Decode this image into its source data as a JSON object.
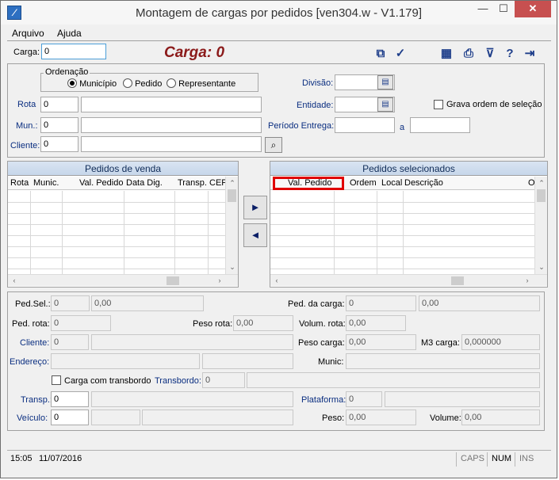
{
  "window": {
    "title": "Montagem de cargas por pedidos [ven304.w - V1.179]",
    "controls": {
      "minimize": "—",
      "maximize": "☐",
      "close": "✕"
    }
  },
  "menu": {
    "arquivo": "Arquivo",
    "ajuda": "Ajuda"
  },
  "header": {
    "carga_label": "Carga:",
    "carga_value": "0",
    "carga_big_label": "Carga:",
    "carga_big_value": "0"
  },
  "toolbar_icons": [
    "copy-icon",
    "confirm-check-icon",
    "calculator-icon",
    "print-icon",
    "filter-icon",
    "help-icon",
    "exit-icon"
  ],
  "filters": {
    "ordenacao_label": "Ordenação",
    "radio_municipio": "Município",
    "radio_pedido": "Pedido",
    "radio_representante": "Representante",
    "selected_radio": "Município",
    "rota_label": "Rota",
    "rota_value": "0",
    "rota_desc": "",
    "mun_label": "Mun.:",
    "mun_value": "0",
    "mun_desc": "",
    "cliente_label": "Cliente:",
    "cliente_value": "0",
    "cliente_desc": "",
    "divisao_label": "Divisão:",
    "divisao_value": "",
    "entidade_label": "Entidade:",
    "entidade_value": "",
    "grava_ordem_label": "Grava ordem de seleção",
    "grava_ordem_checked": false,
    "periodo_label": "Período Entrega:",
    "periodo_sep": "a",
    "periodo_de": "",
    "periodo_ate": ""
  },
  "pedidos_venda": {
    "title": "Pedidos de venda",
    "columns": [
      "Rota",
      "Munic.",
      "Val. Pedido",
      "Data Dig.",
      "Transp.",
      "CEP"
    ],
    "rows": []
  },
  "pedidos_selecionados": {
    "title": "Pedidos selecionados",
    "columns": [
      "Val. Pedido",
      "Ordem",
      "Local",
      "Descrição",
      "O"
    ],
    "rows": []
  },
  "move_buttons": {
    "add": "►",
    "remove": "◄"
  },
  "details": {
    "ped_sel_label": "Ped.Sel.:",
    "ped_sel_value": "0",
    "ped_sel_total": "0,00",
    "ped_carga_label": "Ped. da carga:",
    "ped_carga_value": "0",
    "ped_carga_total": "0,00",
    "ped_rota_label": "Ped. rota:",
    "ped_rota_value": "0",
    "peso_rota_label": "Peso rota:",
    "peso_rota_value": "0,00",
    "volum_rota_label": "Volum. rota:",
    "volum_rota_value": "0,00",
    "cliente_label": "Cliente:",
    "cliente_value": "0",
    "cliente_desc": "",
    "peso_carga_label": "Peso carga:",
    "peso_carga_value": "0,00",
    "m3_carga_label": "M3 carga:",
    "m3_carga_value": "0,000000",
    "endereco_label": "Endereço:",
    "endereco_value": "",
    "endereco_extra": "",
    "munic_label": "Munic:",
    "munic_value": "",
    "transbordo_check_label": "Carga com transbordo",
    "transbordo_checked": false,
    "transbordo_label": "Transbordo:",
    "transbordo_value": "0",
    "transbordo_desc": "",
    "transp_label": "Transp.:",
    "transp_value": "0",
    "transp_desc": "",
    "plataforma_label": "Plataforma:",
    "plataforma_value": "0",
    "plataforma_desc": "",
    "veiculo_label": "Veículo:",
    "veiculo_value": "0",
    "veiculo_code": "",
    "veiculo_desc": "",
    "peso_label": "Peso:",
    "peso_value": "0,00",
    "volume_label": "Volume:",
    "volume_value": "0,00"
  },
  "status": {
    "time": "15:05",
    "date": "11/07/2016",
    "caps": "CAPS",
    "num": "NUM",
    "ins": "INS"
  },
  "colors": {
    "carga_big": "#8b1a1a",
    "field_label_blue": "#0a2e80",
    "grid_header": "#c6d6ea",
    "highlight_box": "#e00000",
    "close_button": "#c75050"
  }
}
